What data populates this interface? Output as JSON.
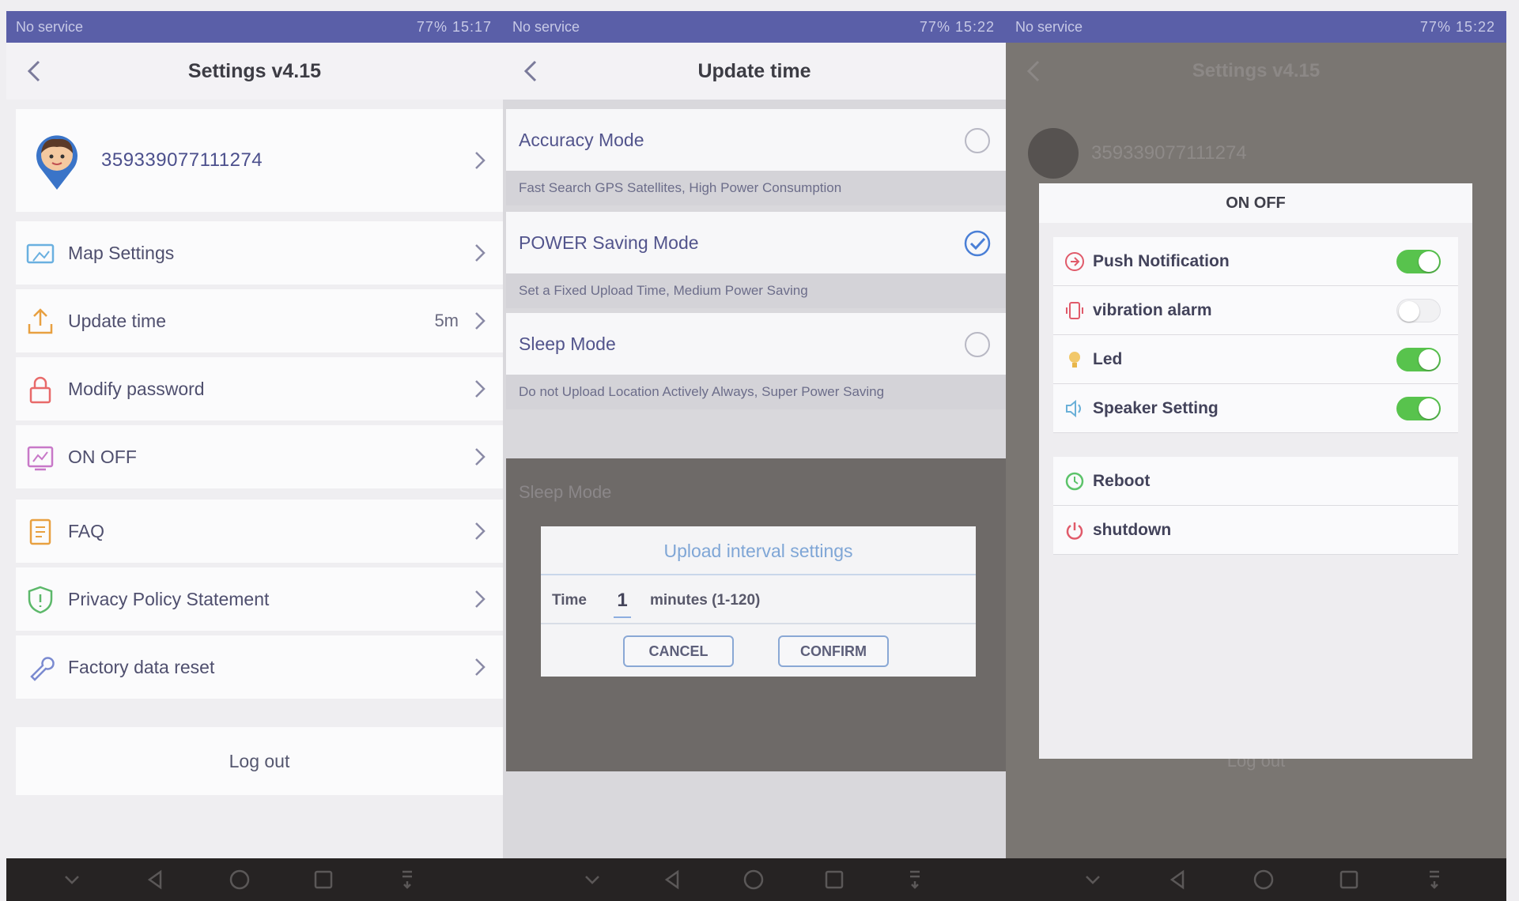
{
  "status_bar": {
    "panels": [
      {
        "carrier": "No service",
        "right": "77% 15:17"
      },
      {
        "carrier": "No service",
        "right": "77% 15:22"
      },
      {
        "carrier": "No service",
        "right": "77% 15:22"
      }
    ]
  },
  "settings": {
    "title": "Settings v4.15",
    "device_id": "359339077111274",
    "menu": [
      {
        "label": "Map Settings",
        "value": "",
        "icon": "map-icon"
      },
      {
        "label": "Update time",
        "value": "5m",
        "icon": "upload-icon"
      },
      {
        "label": "Modify password",
        "value": "",
        "icon": "lock-icon"
      },
      {
        "label": "ON OFF",
        "value": "",
        "icon": "power-chart-icon"
      },
      {
        "label": "FAQ",
        "value": "",
        "icon": "faq-icon"
      },
      {
        "label": "Privacy Policy Statement",
        "value": "",
        "icon": "shield-icon"
      },
      {
        "label": "Factory data reset",
        "value": "",
        "icon": "wrench-icon"
      }
    ],
    "logout": "Log out"
  },
  "update_time": {
    "title": "Update time",
    "modes": [
      {
        "label": "Accuracy Mode",
        "desc": "Fast Search GPS Satellites, High Power Consumption",
        "selected": false
      },
      {
        "label": "POWER Saving Mode",
        "desc": "Set a Fixed Upload Time, Medium Power Saving",
        "selected": true
      },
      {
        "label": "Sleep Mode",
        "desc": "Do not Upload Location Actively Always, Super Power Saving",
        "selected": false
      }
    ],
    "dim_label": "Sleep Mode",
    "dialog": {
      "title": "Upload interval settings",
      "time_label": "Time",
      "time_value": "1",
      "unit": "minutes (1-120)",
      "cancel": "CANCEL",
      "confirm": "CONFIRM"
    }
  },
  "on_off": {
    "dim_title": "Settings v4.15",
    "dim_device_id": "359339077111274",
    "dim_logout": "Log out",
    "sheet_title": "ON OFF",
    "toggles": [
      {
        "label": "Push Notification",
        "on": true,
        "icon": "bell-icon",
        "color": "#e05a6a"
      },
      {
        "label": "vibration alarm",
        "on": false,
        "icon": "vibrate-icon",
        "color": "#e05a6a"
      },
      {
        "label": "Led",
        "on": true,
        "icon": "bulb-icon",
        "color": "#e8b64a"
      },
      {
        "label": "Speaker Setting",
        "on": true,
        "icon": "speaker-icon",
        "color": "#6ab0d8"
      }
    ],
    "actions": [
      {
        "label": "Reboot",
        "icon": "reboot-icon",
        "color": "#5cc36a"
      },
      {
        "label": "shutdown",
        "icon": "power-icon",
        "color": "#e05a6a"
      }
    ]
  },
  "colors": {
    "status_bar": "#5a5fa8",
    "accent_blue": "#4a7fd6",
    "switch_on": "#58c34d",
    "icon_orange": "#e8a040"
  }
}
